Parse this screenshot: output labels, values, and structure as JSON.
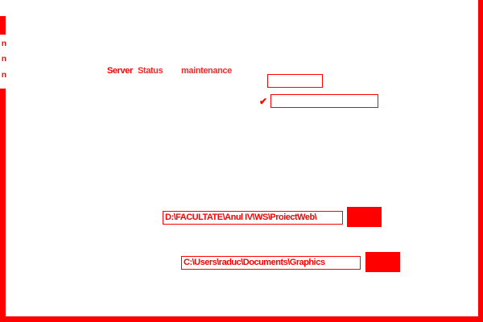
{
  "colors": {
    "accent": "#ff0000",
    "background": "#ffffff"
  },
  "left_fragments": [
    "n",
    "n",
    "n"
  ],
  "overlapping_labels": {
    "line1": "Server",
    "line2": "Status",
    "line3": "maintenance"
  },
  "small_input": {
    "value": ""
  },
  "checkbox": {
    "checked": true,
    "mark": "✔"
  },
  "wide_input": {
    "value": ""
  },
  "path_fields": [
    {
      "value": "D:\\FACULTATE\\Anul IV\\WS\\ProiectWeb\\"
    },
    {
      "value": "C:\\Users\\raduc\\Documents\\Graphics"
    }
  ],
  "browse_buttons": [
    {
      "label": ""
    },
    {
      "label": ""
    }
  ]
}
